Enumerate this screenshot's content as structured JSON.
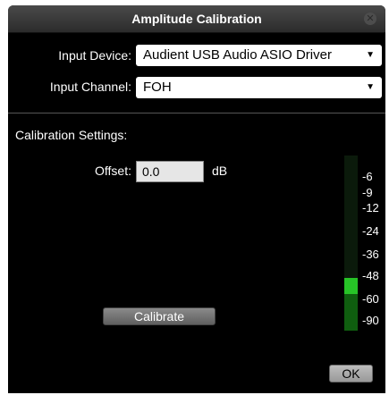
{
  "window": {
    "title": "Amplitude Calibration",
    "close_icon": "close-icon"
  },
  "input_device": {
    "label": "Input Device:",
    "value": "Audient USB Audio ASIO Driver"
  },
  "input_channel": {
    "label": "Input Channel:",
    "value": "FOH"
  },
  "calibration": {
    "section_title": "Calibration Settings:",
    "offset_label": "Offset:",
    "offset_value": "0.0",
    "offset_unit": "dB",
    "calibrate_label": "Calibrate"
  },
  "meter": {
    "scale": [
      "-6",
      "-9",
      "-12",
      "-24",
      "-36",
      "-48",
      "-60",
      "-90"
    ],
    "level_label": "-60",
    "colors": {
      "active": "#27c427",
      "inactive": "#0f5e0f",
      "background": "#0b1a0b"
    }
  },
  "footer": {
    "ok_label": "OK"
  }
}
